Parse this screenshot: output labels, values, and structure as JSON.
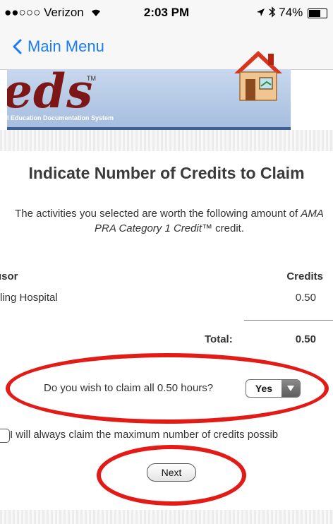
{
  "status_bar": {
    "carrier": "●●○○○ Verizon",
    "time": "2:03 PM",
    "battery": "74%",
    "battery_level": 0.74
  },
  "nav": {
    "back_label": "Main Menu"
  },
  "banner": {
    "logo_text": "eds",
    "trademark": "TM",
    "subtitle": "l Education Documentation System"
  },
  "page": {
    "heading": "Indicate Number of Credits to Claim",
    "description_before": "The activities you selected are worth the following amount of ",
    "description_italic": "AMA PRA Category 1 Credit™",
    "description_after": " credit."
  },
  "table": {
    "col_sponsor": "ısor",
    "col_credits": "Credits",
    "rows": [
      {
        "sponsor": "ling Hospital",
        "credits": "0.50"
      }
    ],
    "total_label": "Total:",
    "total_value": "0.50"
  },
  "claim": {
    "question": "Do you wish to claim all 0.50 hours?",
    "selected": "Yes"
  },
  "always": {
    "label": "I will always claim the maximum number of credits possib"
  },
  "next_label": "Next",
  "colors": {
    "accent": "#1a7cf5",
    "annotation": "#e31b17"
  }
}
